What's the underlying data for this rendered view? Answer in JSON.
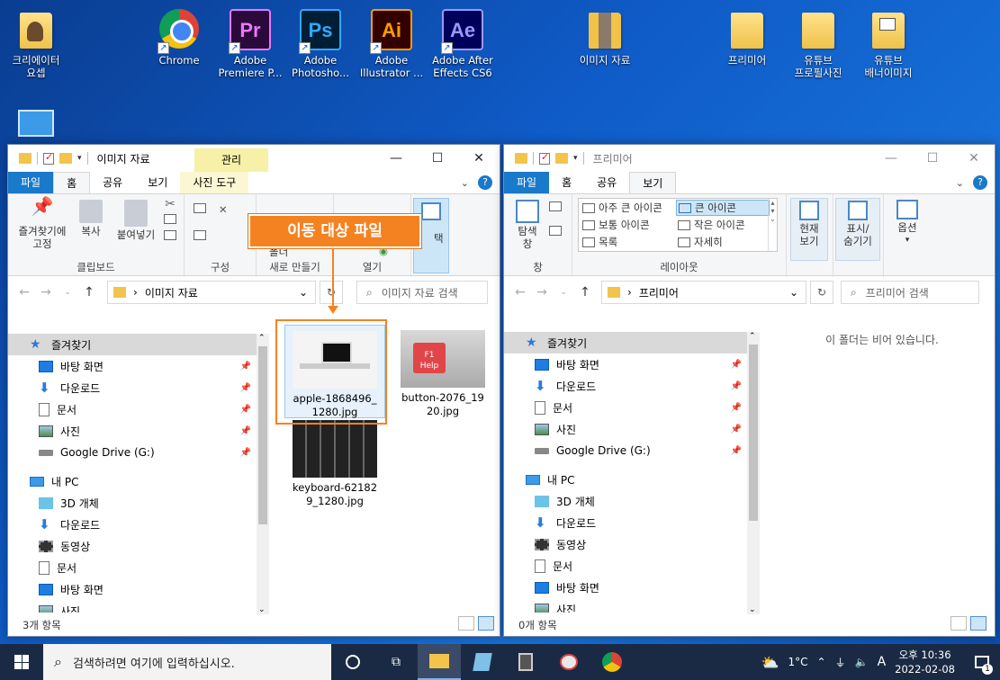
{
  "desktop": {
    "icons": [
      {
        "label": "크리에이터\n요셉"
      },
      {
        "label": "Chrome"
      },
      {
        "label": "Adobe\nPremiere P...",
        "abbr": "Pr",
        "color": "#ea77ff",
        "bg": "#2a0a3a"
      },
      {
        "label": "Adobe\nPhotosho...",
        "abbr": "Ps",
        "color": "#31a8ff",
        "bg": "#001e36"
      },
      {
        "label": "Adobe\nIllustrator ...",
        "abbr": "Ai",
        "color": "#ff9a00",
        "bg": "#330000"
      },
      {
        "label": "Adobe After\nEffects CS6",
        "abbr": "Ae",
        "color": "#9999ff",
        "bg": "#00005b"
      },
      {
        "label": "이미지 자료"
      },
      {
        "label": "프리미어"
      },
      {
        "label": "유튜브\n프로필사진"
      },
      {
        "label": "유튜브\n배너이미지"
      }
    ]
  },
  "left_window": {
    "title": "이미지 자료",
    "manage_tab": "관리",
    "tabs": [
      "파일",
      "홈",
      "공유",
      "보기",
      "사진 도구"
    ],
    "ribbon": {
      "pin_label": "즐겨찾기에\n고정",
      "copy_label": "복사",
      "paste_label": "붙여넣기",
      "clipboard_group": "클립보드",
      "organize_group": "구성",
      "new_folder": "폴더",
      "new_group": "새로 만들기",
      "open_group": "열기",
      "select_partial": "택"
    },
    "address": "이미지 자료",
    "search_placeholder": "이미지 자료 검색",
    "nav": [
      {
        "label": "즐겨찾기",
        "icon": "star"
      },
      {
        "label": "바탕 화면",
        "icon": "desk",
        "pin": true
      },
      {
        "label": "다운로드",
        "icon": "down",
        "pin": true
      },
      {
        "label": "문서",
        "icon": "doc",
        "pin": true
      },
      {
        "label": "사진",
        "icon": "pic",
        "pin": true
      },
      {
        "label": "Google Drive (G:)",
        "icon": "drive",
        "pin": true
      },
      {
        "label": "내 PC",
        "icon": "pc"
      },
      {
        "label": "3D 개체",
        "icon": "cube"
      },
      {
        "label": "다운로드",
        "icon": "down"
      },
      {
        "label": "동영상",
        "icon": "film"
      },
      {
        "label": "문서",
        "icon": "doc"
      },
      {
        "label": "바탕 화면",
        "icon": "desk"
      },
      {
        "label": "사진",
        "icon": "pic"
      }
    ],
    "files": [
      {
        "name": "apple-1868496_\n1280.jpg"
      },
      {
        "name": "button-2076_19\n20.jpg"
      },
      {
        "name": "keyboard-62182\n9_1280.jpg"
      }
    ],
    "status": "3개 항목"
  },
  "right_window": {
    "title": "프리미어",
    "tabs": [
      "파일",
      "홈",
      "공유",
      "보기"
    ],
    "ribbon": {
      "nav_pane_label": "탐색\n창",
      "pane_group": "창",
      "layout_items": [
        "아주 큰 아이콘",
        "큰 아이콘",
        "보통 아이콘",
        "작은 아이콘",
        "목록",
        "자세히"
      ],
      "layout_group": "레이아웃",
      "current_view": "현재\n보기",
      "show_hide": "표시/\n숨기기",
      "options": "옵션"
    },
    "address": "프리미어",
    "search_placeholder": "프리미어 검색",
    "empty_message": "이 폴더는 비어 있습니다.",
    "nav": [
      {
        "label": "즐겨찾기",
        "icon": "star"
      },
      {
        "label": "바탕 화면",
        "icon": "desk",
        "pin": true
      },
      {
        "label": "다운로드",
        "icon": "down",
        "pin": true
      },
      {
        "label": "문서",
        "icon": "doc",
        "pin": true
      },
      {
        "label": "사진",
        "icon": "pic",
        "pin": true
      },
      {
        "label": "Google Drive (G:)",
        "icon": "drive",
        "pin": true
      },
      {
        "label": "내 PC",
        "icon": "pc"
      },
      {
        "label": "3D 개체",
        "icon": "cube"
      },
      {
        "label": "다운로드",
        "icon": "down"
      },
      {
        "label": "동영상",
        "icon": "film"
      },
      {
        "label": "문서",
        "icon": "doc"
      },
      {
        "label": "바탕 화면",
        "icon": "desk"
      },
      {
        "label": "사진",
        "icon": "pic"
      }
    ],
    "status": "0개 항목"
  },
  "callout": {
    "text": "이동 대상 파일",
    "color": "#f58220"
  },
  "taskbar": {
    "search_placeholder": "검색하려면 여기에 입력하십시오.",
    "weather": "1°C",
    "ime": "A",
    "time": "오후 10:36",
    "date": "2022-02-08",
    "notification_count": "1"
  }
}
